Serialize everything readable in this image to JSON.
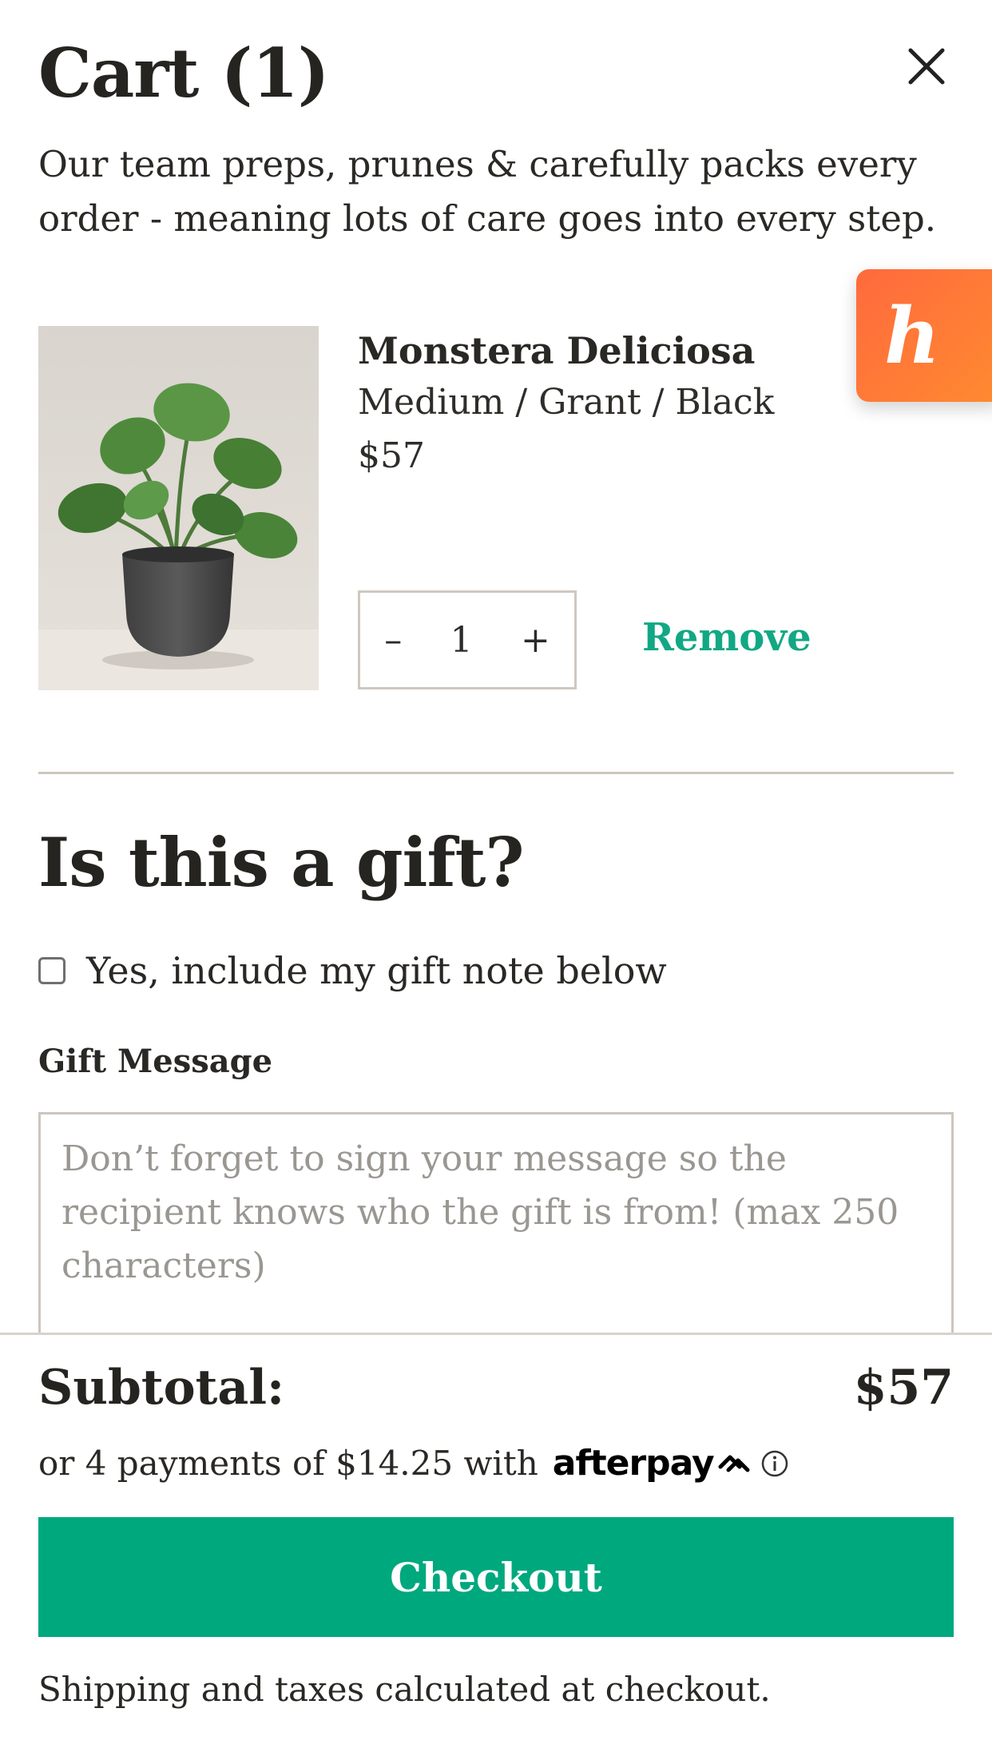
{
  "cart": {
    "title": "Cart (1)",
    "intro": "Our team preps, prunes & carefully packs every order - meaning lots of care goes into every step."
  },
  "honey": {
    "glyph": "h"
  },
  "item": {
    "name": "Monstera Deliciosa",
    "variant": "Medium / Grant / Black",
    "price": "$57",
    "quantity": "1",
    "decrement": "–",
    "increment": "+",
    "remove_label": "Remove"
  },
  "gift": {
    "heading": "Is this a gift?",
    "checkbox_label": "Yes, include my gift note below",
    "message_label": "Gift Message",
    "message_placeholder": "Don’t forget to sign your message so the recipient knows who the gift is from! (max 250 characters)",
    "message_value": ""
  },
  "summary": {
    "subtotal_label": "Subtotal:",
    "subtotal_value": "$57",
    "installments_text": "or 4 payments of $14.25 with",
    "afterpay_brand": "afterpay",
    "checkout_label": "Checkout",
    "shipping_note": "Shipping and taxes calculated at checkout."
  },
  "colors": {
    "accent": "#00a87e",
    "remove_link": "#11a883",
    "honey_badge": "#ff7a35"
  }
}
